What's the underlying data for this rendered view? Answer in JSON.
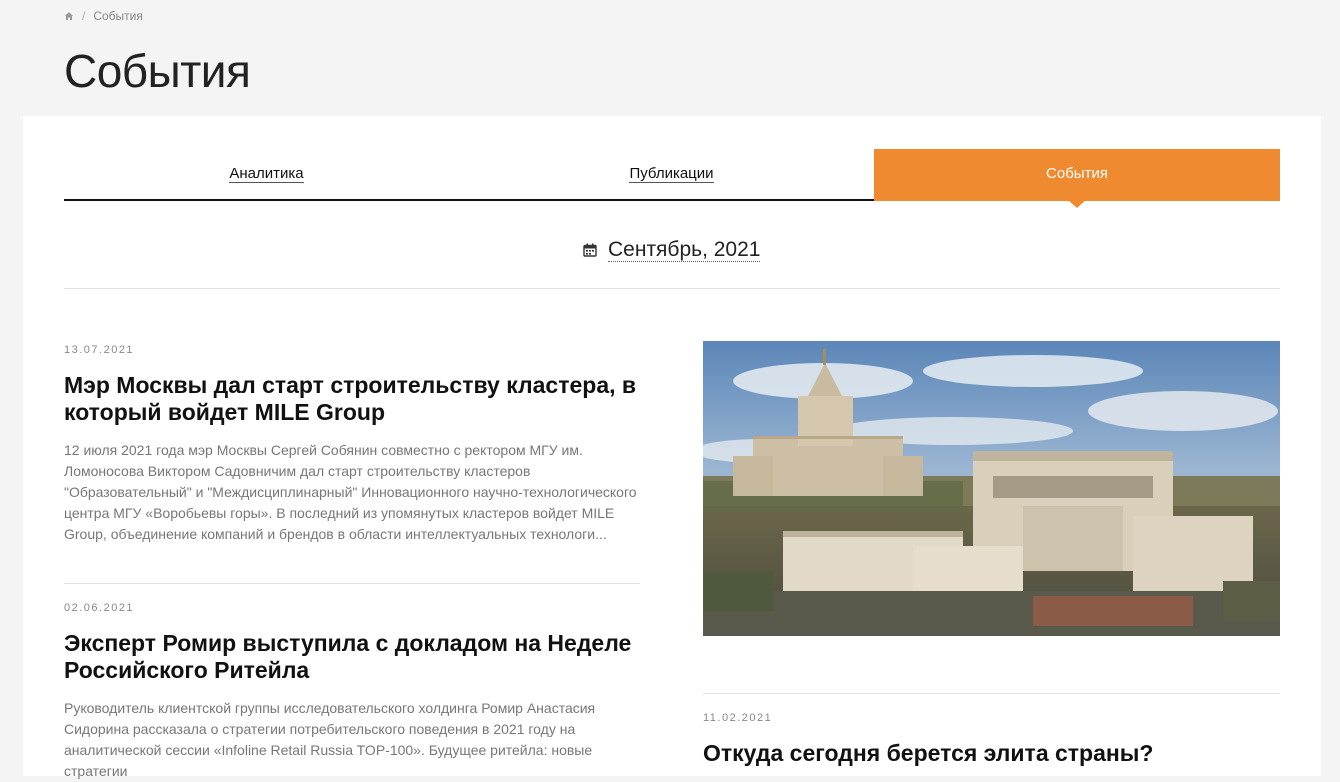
{
  "breadcrumb": {
    "home_icon": "home-icon",
    "separator": "/",
    "current": "События"
  },
  "page": {
    "title": "События"
  },
  "tabs": [
    {
      "label": "Аналитика",
      "active": false
    },
    {
      "label": "Публикации",
      "active": false
    },
    {
      "label": "События",
      "active": true
    }
  ],
  "filter": {
    "icon": "calendar-icon",
    "month": "Сентябрь, 2021"
  },
  "articles": [
    {
      "date": "13.07.2021",
      "title": "Мэр Москвы дал старт строительству кластера, в который войдет MILE Group",
      "excerpt": "12 июля 2021 года мэр Москвы Сергей Собянин совместно с ректором МГУ им. Ломоносова Виктором Садовничим дал старт строительству кластеров \"Образовательный\" и \"Междисциплинарный\" Инновационного научно-технологического центра МГУ «Воробьевы горы». В последний из упомянутых кластеров войдет MILE Group, объединение компаний и брендов в области интеллектуальных технологи..."
    },
    {
      "date": "02.06.2021",
      "title": "Эксперт Ромир выступила с докладом на Неделе Российского Ритейла",
      "excerpt": "Руководитель клиентской группы исследовательского холдинга Ромир Анастасия Сидорина рассказала о стратегии потребительского поведения в 2021 году на аналитической сессии «Infoline Retail Russia TOP-100». Будущее ритейла: новые стратегии"
    },
    {
      "date": "11.02.2021",
      "title": "Откуда сегодня берется элита страны?"
    }
  ],
  "colors": {
    "accent": "#f08a30",
    "background": "#f4f4f4",
    "card": "#ffffff",
    "muted_text": "#777777"
  }
}
